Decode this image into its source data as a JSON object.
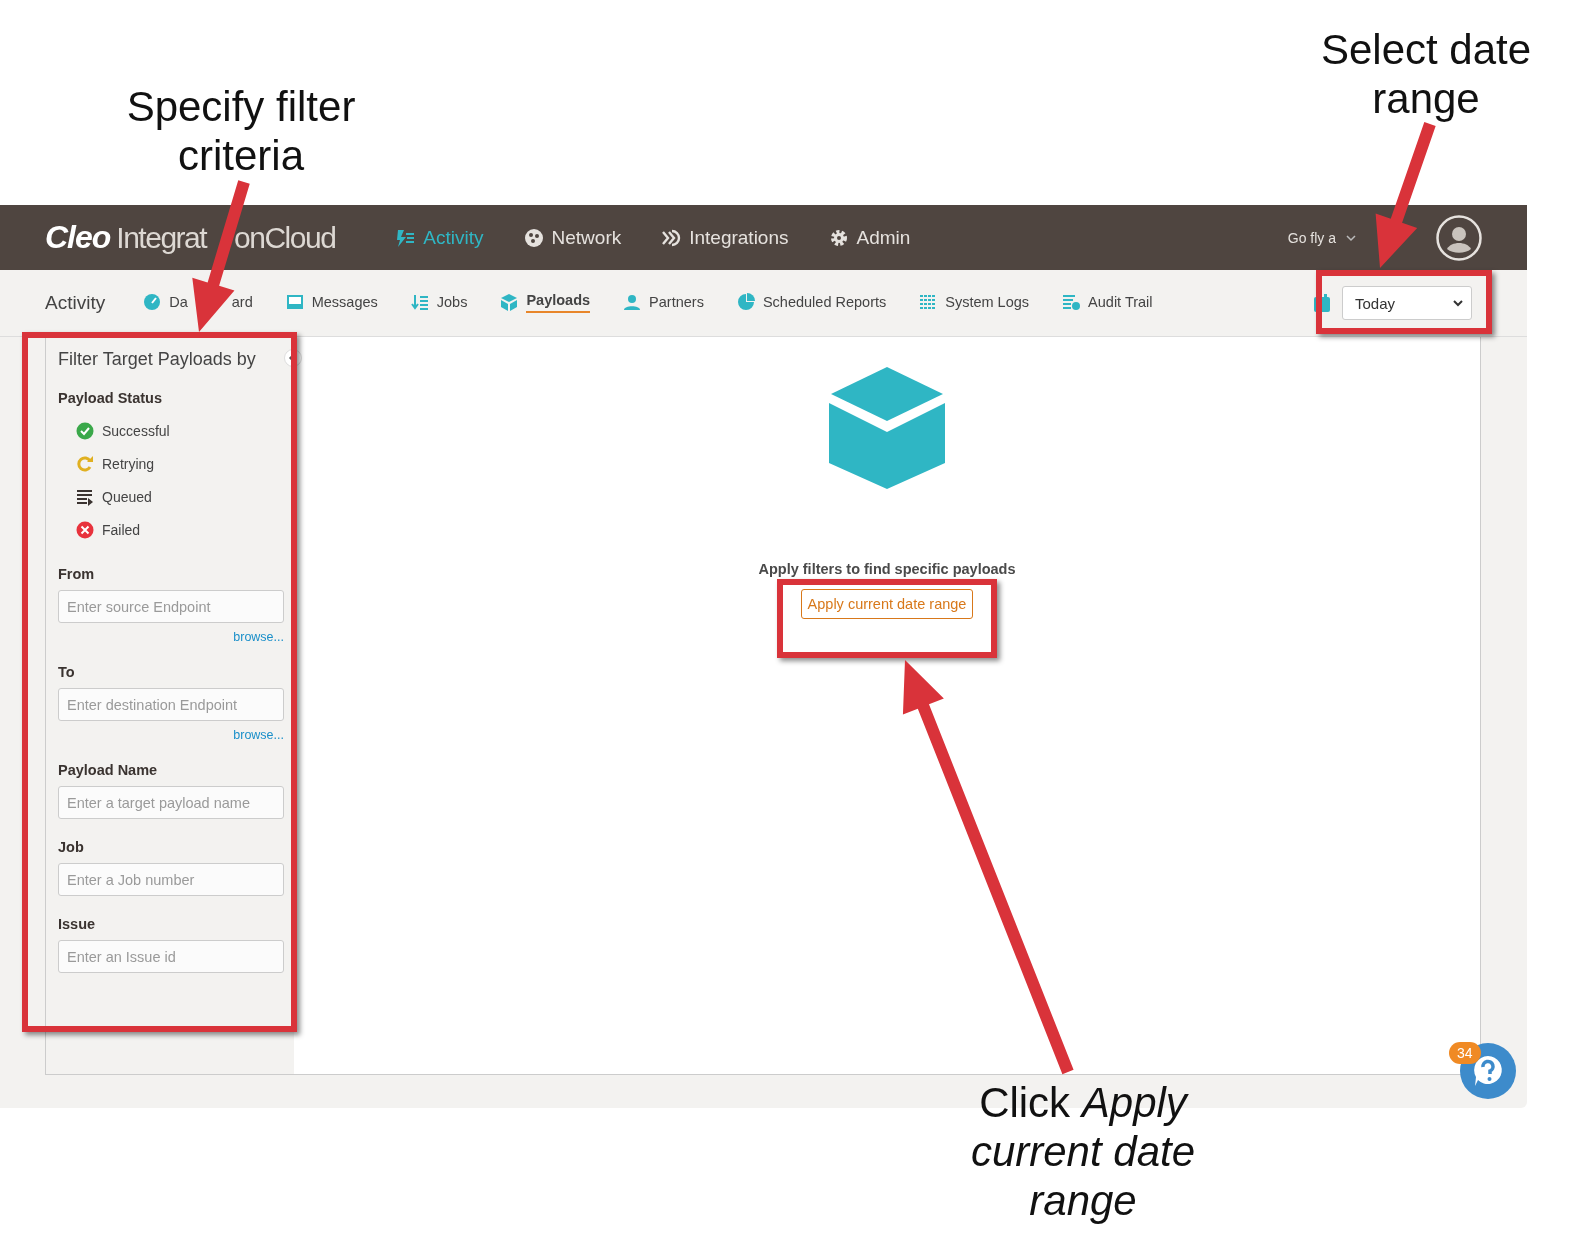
{
  "header": {
    "logo": {
      "brand": "Cleo",
      "product_parts": [
        "Integrat",
        "onCloud"
      ]
    },
    "nav": [
      {
        "label": "Activity",
        "selected": true
      },
      {
        "label": "Network",
        "selected": false
      },
      {
        "label": "Integrations",
        "selected": false
      },
      {
        "label": "Admin",
        "selected": false
      }
    ],
    "user": {
      "name": "Go fly a"
    }
  },
  "subnav": {
    "title": "Activity",
    "tabs": [
      {
        "label_parts": [
          "Da",
          "ard"
        ],
        "selected": false
      },
      {
        "label": "Messages",
        "selected": false
      },
      {
        "label": "Jobs",
        "selected": false
      },
      {
        "label": "Payloads",
        "selected": true
      },
      {
        "label": "Partners",
        "selected": false
      },
      {
        "label": "Scheduled Reports",
        "selected": false
      },
      {
        "label": "System Logs",
        "selected": false
      },
      {
        "label": "Audit Trail",
        "selected": false
      }
    ],
    "date_range": {
      "value": "Today"
    }
  },
  "filter_panel": {
    "title": "Filter Target Payloads by",
    "status_heading": "Payload Status",
    "statuses": [
      {
        "label": "Successful",
        "kind": "success"
      },
      {
        "label": "Retrying",
        "kind": "retrying"
      },
      {
        "label": "Queued",
        "kind": "queued"
      },
      {
        "label": "Failed",
        "kind": "failed"
      }
    ],
    "fields": [
      {
        "label": "From",
        "placeholder": "Enter source Endpoint",
        "link": "browse..."
      },
      {
        "label": "To",
        "placeholder": "Enter destination Endpoint",
        "link": "browse..."
      },
      {
        "label": "Payload Name",
        "placeholder": "Enter a target payload name"
      },
      {
        "label": "Job",
        "placeholder": "Enter a Job number"
      },
      {
        "label": "Issue",
        "placeholder": "Enter an Issue id"
      }
    ]
  },
  "empty_state": {
    "message": "Apply filters to find specific payloads",
    "button": "Apply current date range"
  },
  "help": {
    "badge": "34"
  },
  "annotations": [
    {
      "text": "Specify filter criteria"
    },
    {
      "text": "Select date range"
    },
    {
      "text": "Click *Apply current date range*"
    }
  ]
}
